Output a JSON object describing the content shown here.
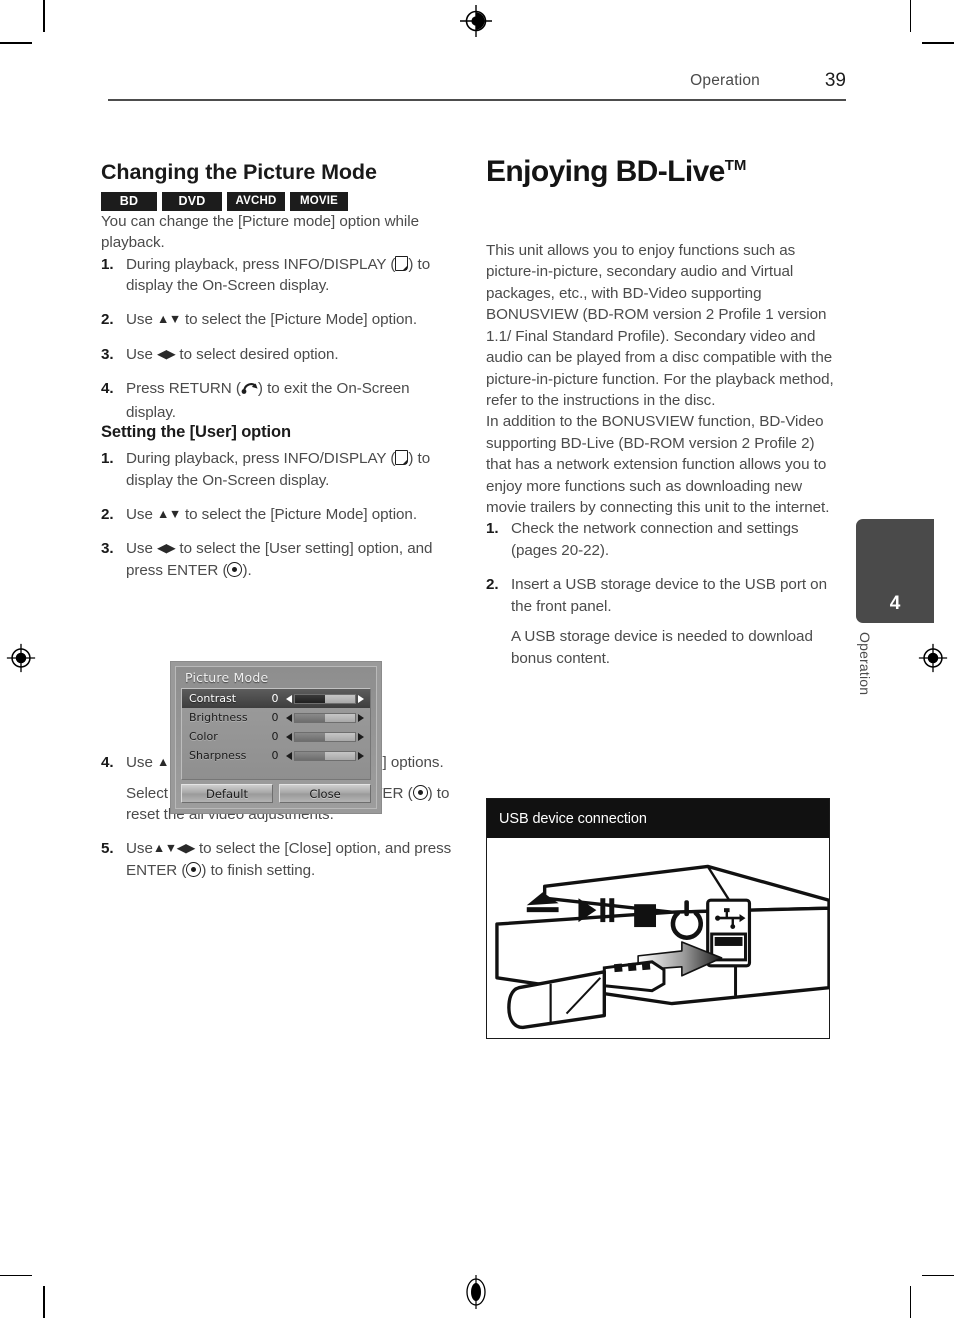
{
  "header": {
    "section": "Operation",
    "page_number": "39"
  },
  "left_column": {
    "title": "Changing the Picture Mode",
    "badges": [
      {
        "label": "BD",
        "class": "w-bd"
      },
      {
        "label": "DVD",
        "class": "w-dvd"
      },
      {
        "label": "AVCHD",
        "class": "w-avchd"
      },
      {
        "label": "MOVIE",
        "class": "w-movie"
      }
    ],
    "intro": "You can change the [Picture mode] option while playback.",
    "steps": [
      {
        "num": "1.",
        "pre": "During playback, press INFO/DISPLAY (",
        "icon": "display-key-icon",
        "post": ") to display the On-Screen display."
      },
      {
        "num": "2.",
        "pre": "Use ",
        "arrows": "▲▼",
        "post": " to select the [Picture Mode] option."
      },
      {
        "num": "3.",
        "pre": "Use  ",
        "arrows": "◀▶",
        "post": " to select desired option."
      },
      {
        "num": "4.",
        "pre": "Press RETURN (",
        "icon": "return-key-icon",
        "post": ") to exit the On-Screen display."
      }
    ],
    "subsection_title": "Setting the [User] option",
    "sub_steps": [
      {
        "num": "1.",
        "pre": "During playback, press INFO/DISPLAY (",
        "icon": "display-key-icon",
        "post": ") to display the On-Screen display."
      },
      {
        "num": "2.",
        "pre": "Use ",
        "arrows": "▲▼",
        "post": " to select the [Picture Mode] option."
      },
      {
        "num": "3.",
        "pre": "Use ",
        "arrows": "◀▶",
        "post": " to select the [User setting] option, and press ENTER (",
        "icon2": "enter-key-icon",
        "post2": ")."
      },
      {
        "num": "4.",
        "pre": "Use ",
        "arrows": "▲▼◀▶",
        "post": " to adjust the [Picture Mode] options.",
        "sub_pre": "Select [Default] option then press ENTER (",
        "sub_icon": "enter-key-icon",
        "sub_post": ") to reset the all video adjustments."
      },
      {
        "num": "5.",
        "pre": "Use",
        "arrows": "▲▼◀▶",
        "post": " to select the [Close] option, and press ENTER (",
        "icon2": "enter-key-icon",
        "post2": ") to finish setting."
      }
    ]
  },
  "osd": {
    "title": "Picture Mode",
    "rows": [
      {
        "label": "Contrast",
        "value": "0",
        "fill": 50,
        "selected": true
      },
      {
        "label": "Brightness",
        "value": "0",
        "fill": 50,
        "selected": false
      },
      {
        "label": "Color",
        "value": "0",
        "fill": 50,
        "selected": false
      },
      {
        "label": "Sharpness",
        "value": "0",
        "fill": 50,
        "selected": false
      }
    ],
    "buttons": [
      {
        "label": "Default"
      },
      {
        "label": "Close"
      }
    ]
  },
  "right_column": {
    "title": "Enjoying BD-Live",
    "title_sup": "TM",
    "paragraph_1": "This unit allows you to enjoy functions such as picture-in-picture, secondary audio and Virtual packages, etc., with BD-Video supporting BONUSVIEW (BD-ROM version 2 Profile 1 version 1.1/ Final Standard Profile). Secondary video and audio can be played from a disc compatible with the picture-in-picture function. For the playback method, refer to the instructions in the disc.",
    "paragraph_2": "In addition to the BONUSVIEW function, BD-Video supporting BD-Live (BD-ROM version 2 Profile 2) that has a network extension function allows you to enjoy more functions such as downloading new movie trailers by connecting this unit to the internet.",
    "steps": [
      {
        "num": "1.",
        "text": "Check the network connection and settings (pages 20-22)."
      },
      {
        "num": "2.",
        "text": "Insert a USB storage device to the USB port on the front panel.",
        "sub_text": "A USB storage device is needed to download bonus content."
      }
    ]
  },
  "usb_figure": {
    "caption": "USB device connection",
    "panel_icons": [
      "eject-icon",
      "play-pause-icon",
      "stop-icon",
      "power-icon",
      "usb-port-icon"
    ]
  },
  "chapter_tab": {
    "number": "4",
    "label": "Operation"
  },
  "colors": {
    "text": "#4b4b4b",
    "heading": "#1a1a1a",
    "badge_bg": "#1c1c1c",
    "rule": "#4d4d4d",
    "tab_bg": "#4a4a4a"
  }
}
